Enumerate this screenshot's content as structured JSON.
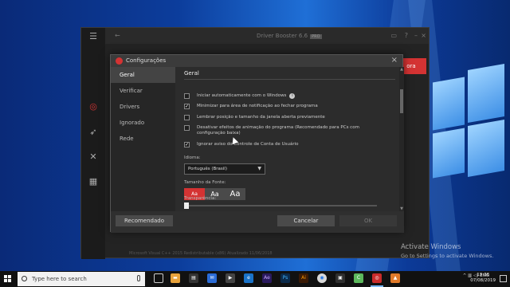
{
  "background_app": {
    "title": "Driver Booster 6.6",
    "badge": "PRO",
    "action_button": "ora",
    "list_row_text": "Microsoft Visual C++ 2015 Redistributable (x86)       Atualizado   11/06/2018"
  },
  "dialog": {
    "title": "Configurações",
    "nav": [
      {
        "label": "Geral"
      },
      {
        "label": "Verificar"
      },
      {
        "label": "Drivers"
      },
      {
        "label": "Ignorado"
      },
      {
        "label": "Rede"
      }
    ],
    "section_title": "Geral",
    "options": [
      {
        "label": "Iniciar automaticamente com o Windows",
        "checked": false
      },
      {
        "label": "Minimizar para área de notificação ao fechar programa",
        "checked": true
      },
      {
        "label": "Lembrar posição e tamanho da janela aberta previamente",
        "checked": false
      },
      {
        "label": "Desativar efeitos de animação do programa (Recomendado para PCs com",
        "label2": "configuração baixa)",
        "checked": false
      },
      {
        "label": "Ignorar aviso do Controle de Conta de Usuário",
        "checked": true
      }
    ],
    "language_label": "Idioma:",
    "language_value": "Português (Brasil)",
    "font_size_label": "Tamanho da Fonte:",
    "font_sizes": [
      "Aa",
      "Aa",
      "Aa"
    ],
    "transparency_label": "Transparência:",
    "transparency_value": 0,
    "buttons": {
      "recommended": "Recomendado",
      "cancel": "Cancelar",
      "ok": "OK"
    }
  },
  "activate": {
    "line1": "Activate Windows",
    "line2": "Go to Settings to activate Windows."
  },
  "taskbar": {
    "search_placeholder": "Type here to search",
    "language": "ENG",
    "time": "13:36",
    "date": "07/08/2019"
  },
  "colors": {
    "accent": "#d43333",
    "dialog_bg": "#2f2f2f",
    "desktop": "#0c3d9c"
  }
}
